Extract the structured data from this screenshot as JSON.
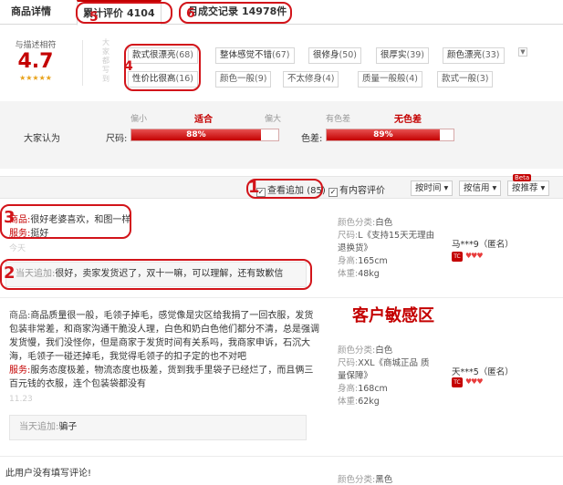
{
  "tabs": [
    {
      "label": "商品详情"
    },
    {
      "label": "累计评价",
      "count": "4104"
    },
    {
      "label": "月成交记录",
      "count": "14978件"
    }
  ],
  "rating": {
    "label": "与描述相符",
    "score": "4.7",
    "stars": "★★★★★",
    "vertical_label": "大家都写到",
    "tags_row1": [
      {
        "text": "款式很漂亮",
        "count": "(68)"
      },
      {
        "text": "整体感觉不错",
        "count": "(67)"
      },
      {
        "text": "很修身",
        "count": "(50)"
      },
      {
        "text": "很厚实",
        "count": "(39)"
      },
      {
        "text": "颜色漂亮",
        "count": "(33)"
      }
    ],
    "tags_row2": [
      {
        "text": "性价比很高",
        "count": "(16)"
      },
      {
        "text": "颜色一般",
        "count": "(9)"
      },
      {
        "text": "不太修身",
        "count": "(4)"
      },
      {
        "text": "质量一般般",
        "count": "(4)"
      },
      {
        "text": "款式一般",
        "count": "(3)"
      }
    ],
    "more_icon": "chevron-down-icon"
  },
  "size_feedback": {
    "title": "大家认为",
    "size": {
      "key": "尺码:",
      "left": "偏小",
      "mid": "适合",
      "right": "偏大",
      "value": "88%",
      "fraction": 0.88
    },
    "color": {
      "key": "色差:",
      "left": "有色差",
      "mid": "无色差",
      "value": "89%",
      "fraction": 0.89
    }
  },
  "filter": {
    "append_label": "查看追加",
    "append_count": "(85)",
    "content_label": "有内容评价",
    "sort_time": "按时间 ▾",
    "sort_credit": "按信用 ▾",
    "sort_recommend": "按推荐 ▾",
    "beta": "Beta"
  },
  "reviews": [
    {
      "product_key": "商品:",
      "product_text": "很好老婆喜欢，和图一样",
      "service_key": "服务:",
      "service_text": "挺好",
      "date": "今天",
      "append_label": "当天追加:",
      "append_text": "很好，卖家发货迟了，双十一嘛，可以理解，还有致歉信",
      "meta": [
        {
          "k": "颜色分类:",
          "v": "白色"
        },
        {
          "k": "尺码:",
          "v": "L《支持15天无理由退换货》"
        },
        {
          "k": "身高:",
          "v": "165cm"
        },
        {
          "k": "体重:",
          "v": "48kg"
        }
      ],
      "user": "马***9（匿名）",
      "badge": "TC"
    },
    {
      "product_key": "商品:",
      "product_text": "商品质量很一般，毛领子掉毛，感觉像是灾区给我捐了一回衣服，发货包装非常差，和商家沟通干脆没人理，白色和奶白色他们都分不清，总是强调发货慢，我们没怪你，但是商家于发货时间有关系吗，我商家申诉，石沉大海，毛领子一碰还掉毛，我觉得毛领子的扣子定的也不对吧",
      "service_key": "服务:",
      "service_text": "服务态度极差，物流态度也极差，货到我手里袋子已经烂了，而且俩三百元钱的衣服，连个包装袋都没有",
      "date": "11.23",
      "append_label": "当天追加:",
      "append_text": "骗子",
      "meta": [
        {
          "k": "颜色分类:",
          "v": "白色"
        },
        {
          "k": "尺码:",
          "v": "XXL《商城正品 质量保障》"
        },
        {
          "k": "身高:",
          "v": "168cm"
        },
        {
          "k": "体重:",
          "v": "62kg"
        }
      ],
      "user": "天***5（匿名）",
      "badge": "TC"
    },
    {
      "product_text": "此用户没有填写评论!",
      "meta": [
        {
          "k": "颜色分类:",
          "v": "黑色"
        }
      ]
    }
  ],
  "sensitive_label": "客户敏感区",
  "annotations": [
    "1",
    "2",
    "3",
    "4",
    "5",
    "6"
  ]
}
